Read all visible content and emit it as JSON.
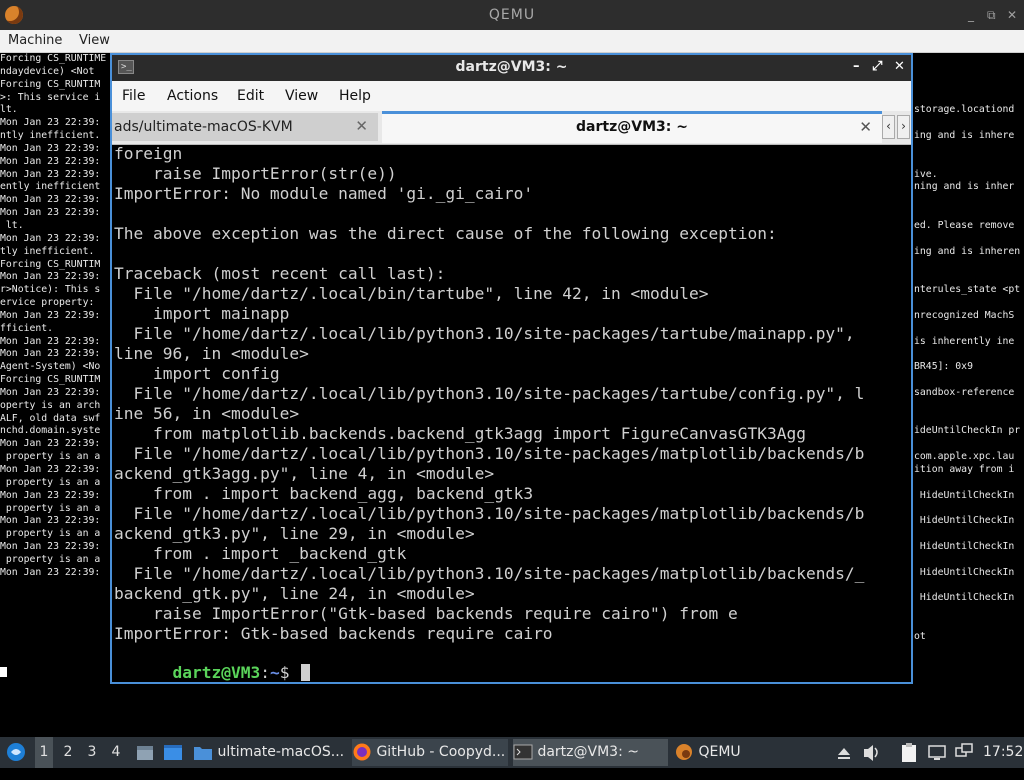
{
  "qemu": {
    "title": "QEMU",
    "controls": {
      "minimize": "_",
      "restore": "⧉",
      "close": "✕"
    },
    "menu": [
      "Machine",
      "View"
    ]
  },
  "guest_log": {
    "left": [
      "Forcing CS_RUNTIME",
      "ndaydevice) <Not",
      "Forcing CS_RUNTIM",
      ">: This service i",
      "lt.",
      "Mon Jan 23 22:39:",
      "ntly inefficient.",
      "Mon Jan 23 22:39:",
      "Mon Jan 23 22:39:",
      "Mon Jan 23 22:39:",
      "ently inefficient",
      "Mon Jan 23 22:39:",
      "Mon Jan 23 22:39:",
      " lt.",
      "Mon Jan 23 22:39:",
      "tly inefficient.",
      "Forcing CS_RUNTIM",
      "Mon Jan 23 22:39:",
      "r>Notice): This s",
      "ervice property: ",
      "Mon Jan 23 22:39:",
      "fficient.",
      "Mon Jan 23 22:39:",
      "Mon Jan 23 22:39:",
      "Agent-System) <No",
      "Forcing CS_RUNTIM",
      "Mon Jan 23 22:39:",
      "operty is an arch",
      "ALF, old data swf",
      "nchd.domain.syste",
      "Mon Jan 23 22:39:",
      " property is an a",
      "Mon Jan 23 22:39:",
      " property is an a",
      "Mon Jan 23 22:39:",
      " property is an a",
      "Mon Jan 23 22:39:",
      " property is an a",
      "Mon Jan 23 22:39:",
      " property is an a",
      "Mon Jan 23 22:39:"
    ],
    "right": [
      "",
      "",
      "",
      "",
      "storage.locationd",
      "",
      "ing and is inhere",
      "",
      "",
      "ive.",
      "ning and is inher",
      "",
      "",
      "ed. Please remove",
      "",
      "ing and is inheren",
      "",
      "",
      "nterules_state <pt",
      "",
      "nrecognized MachS",
      "",
      "is inherently ine",
      "",
      "BR45]: 0x9",
      "",
      "sandbox-reference",
      "",
      "",
      "ideUntilCheckIn pr",
      "",
      "com.apple.xpc.lau",
      "ition away from i",
      "",
      " HideUntilCheckIn",
      "",
      " HideUntilCheckIn",
      "",
      " HideUntilCheckIn",
      "",
      " HideUntilCheckIn",
      "",
      " HideUntilCheckIn",
      "",
      "",
      "ot"
    ]
  },
  "terminal": {
    "title": "dartz@VM3: ~",
    "controls": {
      "minimize": "–",
      "maximize": "⤢",
      "close": "✕"
    },
    "menu": [
      "File",
      "Actions",
      "Edit",
      "View",
      "Help"
    ],
    "tabs": [
      {
        "label": "ads/ultimate-macOS-KVM",
        "active": false
      },
      {
        "label": "dartz@VM3: ~",
        "active": true
      }
    ],
    "tab_close": "✕",
    "tab_prev": "‹",
    "tab_next": "›",
    "lines": [
      "foreign",
      "    raise ImportError(str(e))",
      "ImportError: No module named 'gi._gi_cairo'",
      "",
      "The above exception was the direct cause of the following exception:",
      "",
      "Traceback (most recent call last):",
      "  File \"/home/dartz/.local/bin/tartube\", line 42, in <module>",
      "    import mainapp",
      "  File \"/home/dartz/.local/lib/python3.10/site-packages/tartube/mainapp.py\",",
      "line 96, in <module>",
      "    import config",
      "  File \"/home/dartz/.local/lib/python3.10/site-packages/tartube/config.py\", l",
      "ine 56, in <module>",
      "    from matplotlib.backends.backend_gtk3agg import FigureCanvasGTK3Agg",
      "  File \"/home/dartz/.local/lib/python3.10/site-packages/matplotlib/backends/b",
      "ackend_gtk3agg.py\", line 4, in <module>",
      "    from . import backend_agg, backend_gtk3",
      "  File \"/home/dartz/.local/lib/python3.10/site-packages/matplotlib/backends/b",
      "ackend_gtk3.py\", line 29, in <module>",
      "    from . import _backend_gtk",
      "  File \"/home/dartz/.local/lib/python3.10/site-packages/matplotlib/backends/_",
      "backend_gtk.py\", line 24, in <module>",
      "    raise ImportError(\"Gtk-based backends require cairo\") from e",
      "ImportError: Gtk-based backends require cairo"
    ],
    "prompt": {
      "user": "dartz@VM3",
      "sep": ":",
      "path": "~",
      "symbol": "$ "
    }
  },
  "taskbar": {
    "workspaces": [
      "1",
      "2",
      "3",
      "4"
    ],
    "active_workspace": "1",
    "windows": [
      {
        "label": "ultimate-macOS...",
        "icon": "folder-icon"
      },
      {
        "label": "GitHub - Coopyd...",
        "icon": "firefox-icon"
      },
      {
        "label": "dartz@VM3: ~",
        "icon": "terminal-icon"
      },
      {
        "label": "QEMU",
        "icon": "qemu-icon"
      }
    ],
    "clock": "17:52"
  }
}
